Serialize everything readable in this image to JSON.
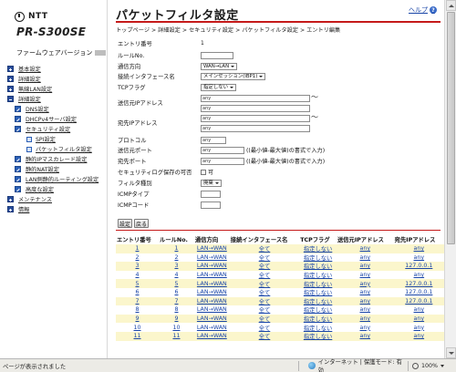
{
  "sidebar": {
    "brand": "NTT",
    "model": "PR-S300SE",
    "firmware_label": "ファームウェアバージョン",
    "menu": [
      {
        "label": "基本設定",
        "level": 0,
        "icon": "plus"
      },
      {
        "label": "詳細設定",
        "level": 0,
        "icon": "plus"
      },
      {
        "label": "無線LAN設定",
        "level": 0,
        "icon": "plus"
      },
      {
        "label": "詳細設定",
        "level": 0,
        "icon": "minus"
      },
      {
        "label": "DNS設定",
        "level": 1,
        "icon": "pencil"
      },
      {
        "label": "DHCPv4サーバ設定",
        "level": 1,
        "icon": "pencil"
      },
      {
        "label": "セキュリティ設定",
        "level": 1,
        "icon": "pencil"
      },
      {
        "label": "SPI設定",
        "level": 2,
        "icon": "small"
      },
      {
        "label": "パケットフィルタ設定",
        "level": 2,
        "icon": "small"
      },
      {
        "label": "静的IPマスカレード設定",
        "level": 1,
        "icon": "pencil"
      },
      {
        "label": "静的NAT設定",
        "level": 1,
        "icon": "pencil"
      },
      {
        "label": "LAN側静的ルーティング設定",
        "level": 1,
        "icon": "pencil"
      },
      {
        "label": "高度な設定",
        "level": 1,
        "icon": "pencil"
      },
      {
        "label": "メンテナンス",
        "level": 0,
        "icon": "plus"
      },
      {
        "label": "情報",
        "level": 0,
        "icon": "plus"
      }
    ]
  },
  "header": {
    "title": "パケットフィルタ設定",
    "help_label": "ヘルプ",
    "help_icon": "?",
    "breadcrumb": "トップページ > 詳細設定 > セキュリティ設定 > パケットフィルタ設定 > エントリ編集"
  },
  "form": {
    "entry_no": {
      "label": "エントリ番号",
      "value": "1"
    },
    "rule_no": {
      "label": "ルールNo.",
      "value": ""
    },
    "direction": {
      "label": "通信方向",
      "value": "WAN→LAN"
    },
    "interface": {
      "label": "接続インタフェース名",
      "value": "メインセッション(IBP1)"
    },
    "tcp_flag": {
      "label": "TCPフラグ",
      "value": "指定しない"
    },
    "src_ip": {
      "label": "送信元IPアドレス",
      "value1": "any",
      "value2": "any"
    },
    "dst_ip": {
      "label": "宛先IPアドレス",
      "value1": "any",
      "value2": "any"
    },
    "protocol": {
      "label": "プロトコル",
      "value": "any"
    },
    "src_port": {
      "label": "送信元ポート",
      "value": "any",
      "hint": "((最小値-最大値)の書式で入力)"
    },
    "dst_port": {
      "label": "宛先ポート",
      "value": "any",
      "hint": "((最小値-最大値)の書式で入力)"
    },
    "log": {
      "label": "セキュリティログ保存の可否",
      "value": "可"
    },
    "filter_type": {
      "label": "フィルタ種別",
      "value": "廃棄"
    },
    "icmp_type": {
      "label": "ICMPタイプ",
      "value": ""
    },
    "icmp_code": {
      "label": "ICMPコード",
      "value": ""
    },
    "tilde": "〜"
  },
  "buttons": {
    "set": "設定",
    "back": "戻る"
  },
  "table": {
    "headers": [
      "エントリ番号",
      "ルールNo.",
      "通信方向",
      "接続インタフェース名",
      "TCPフラグ",
      "送信元IPアドレス",
      "宛先IPアドレス"
    ],
    "rows": [
      [
        "1",
        "1",
        "LAN→WAN",
        "全て",
        "指定しない",
        "any",
        "any"
      ],
      [
        "2",
        "2",
        "LAN→WAN",
        "全て",
        "指定しない",
        "any",
        "any"
      ],
      [
        "3",
        "3",
        "LAN→WAN",
        "全て",
        "指定しない",
        "any",
        "127.0.0.1"
      ],
      [
        "4",
        "4",
        "LAN→WAN",
        "全て",
        "指定しない",
        "any",
        "any"
      ],
      [
        "5",
        "5",
        "LAN→WAN",
        "全て",
        "指定しない",
        "any",
        "127.0.0.1"
      ],
      [
        "6",
        "6",
        "LAN→WAN",
        "全て",
        "指定しない",
        "any",
        "127.0.0.1"
      ],
      [
        "7",
        "7",
        "LAN→WAN",
        "全て",
        "指定しない",
        "any",
        "127.0.0.1"
      ],
      [
        "8",
        "8",
        "LAN→WAN",
        "全て",
        "指定しない",
        "any",
        "any"
      ],
      [
        "9",
        "9",
        "LAN→WAN",
        "全て",
        "指定しない",
        "any",
        "any"
      ],
      [
        "10",
        "10",
        "LAN→WAN",
        "全て",
        "指定しない",
        "any",
        "any"
      ],
      [
        "11",
        "11",
        "LAN→WAN",
        "全て",
        "指定しない",
        "any",
        "any"
      ]
    ]
  },
  "statusbar": {
    "status": "ページが表示されました",
    "zone": "インターネット | 保護モード: 有効",
    "zoom": "100%"
  }
}
